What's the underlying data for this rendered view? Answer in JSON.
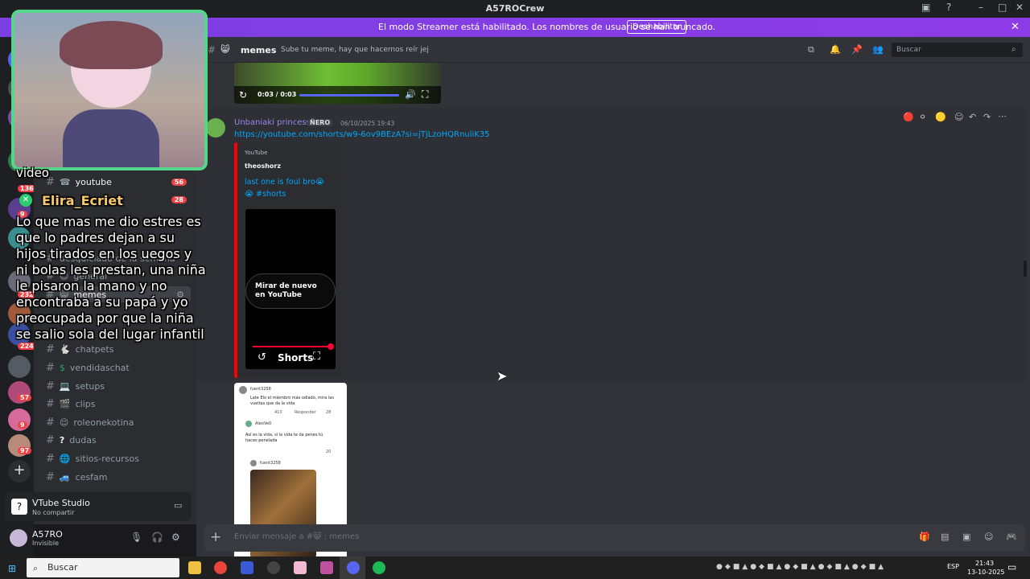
{
  "window": {
    "title": "A57ROCrew"
  },
  "banner": {
    "message": "El modo Streamer está habilitado. Los nombres de usuario se han truncado.",
    "button": "Deshabilitar"
  },
  "channel_header": {
    "name": "memes",
    "topic": "Sube tu meme, hay que hacernos reír jej",
    "search_placeholder": "Buscar"
  },
  "video": {
    "time": "0:03 / 0:03"
  },
  "message": {
    "author": "Unbaniaki princess",
    "role_tag": "ÑERO",
    "timestamp": "06/10/2025 19:43",
    "link": "https://youtube.com/shorts/w9-6ov9BEzA?si=jTjLzoHQRnuliK35",
    "embed": {
      "provider": "YouTube",
      "author": "theoshorz",
      "title": "last one is foul bro😭",
      "hashtag": "😭 #shorts",
      "replay_label": "Mirar de nuevo en YouTube",
      "shorts_label": "Shorts"
    }
  },
  "attachment": {
    "user1": "fuent3258",
    "caption1": "Late Elo el miembro más odiado, mira las vueltas que da la vida",
    "votes1": "410",
    "reply_label": "Responder",
    "likes1": "28",
    "user2": "AleoVe0",
    "caption2": "Así es la vida, si la vida te da penes tú haces penelada",
    "user3": "fuent3258",
    "likes2": "20"
  },
  "channels": [
    {
      "emoji": "☎",
      "name": "youtube",
      "count": "56"
    },
    {
      "emoji": "",
      "name": "",
      "count": "28"
    },
    {
      "emoji": "",
      "name": "desquiciado de la semana",
      "count": ""
    },
    {
      "emoji": "😊",
      "name": "general",
      "count": ""
    },
    {
      "emoji": "😸",
      "name": "memes",
      "count": ""
    },
    {
      "emoji": "🐇",
      "name": "chatpets",
      "count": ""
    },
    {
      "emoji": "$",
      "name": "vendidaschat",
      "count": ""
    },
    {
      "emoji": "💻",
      "name": "setups",
      "count": ""
    },
    {
      "emoji": "🎬",
      "name": "clips",
      "count": ""
    },
    {
      "emoji": "😌",
      "name": "roleonekotina",
      "count": ""
    },
    {
      "emoji": "?",
      "name": "dudas",
      "count": ""
    },
    {
      "emoji": "🌐",
      "name": "sitios-recursos",
      "count": ""
    },
    {
      "emoji": "🚙",
      "name": "cesfam",
      "count": ""
    }
  ],
  "guild_badges": [
    "136",
    "9",
    "232",
    "224",
    "57",
    "9",
    "97"
  ],
  "voice": {
    "app": "VTube Studio",
    "status": "No compartir"
  },
  "user": {
    "name": "A57RO",
    "status": "Invisible"
  },
  "composer": {
    "placeholder": "Enviar mensaje a #😸 : memes"
  },
  "overlay": {
    "top_text": "video",
    "chatter": "Elira_Ecriet",
    "lines": [
      "Lo que mas me dio estres es",
      "que lo padres dejan a su",
      "hijos tirados en los uegos y",
      "ni bolas les prestan, una niña",
      "le pisaron la mano y no",
      "encontraba a su papá y yo",
      "preocupada por que la niña",
      "se salio sola del lugar infantil"
    ]
  },
  "taskbar": {
    "search": "Buscar",
    "lang": "ESP",
    "time": "21:43",
    "date": "13-10-2025"
  },
  "colors": {
    "blurple": "#5865f2",
    "banner": "#8d3be6",
    "link": "#00a8fc",
    "overlay_border": "#55d68a",
    "red": "#f23f43"
  }
}
